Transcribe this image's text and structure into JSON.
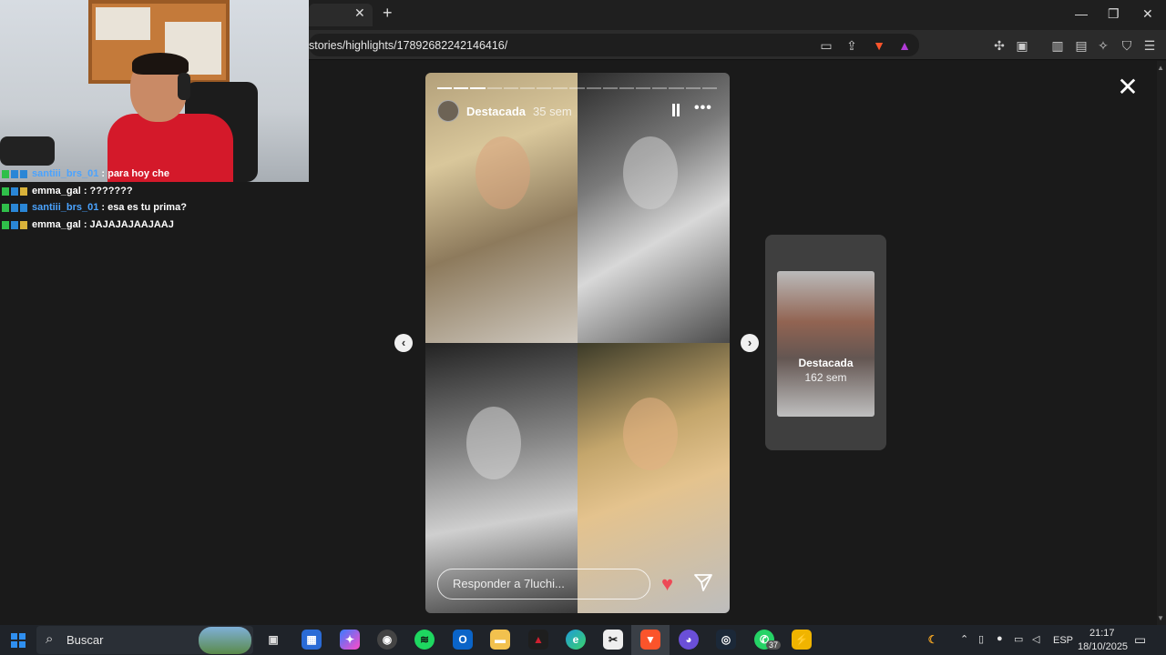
{
  "browser": {
    "url": "stories/highlights/17892682242146416/",
    "tab_close": "✕",
    "new_tab": "+",
    "win_min": "—",
    "win_max": "❐",
    "win_close": "✕"
  },
  "chat": [
    {
      "user": "santiii_brs_01",
      "message": ": para hoy che",
      "user_color": "#4aa3ff"
    },
    {
      "user": "emma_gal",
      "message": ": ???????",
      "user_color": "#ffffff"
    },
    {
      "user": "santiii_brs_01",
      "message": ": esa es tu prima?",
      "user_color": "#4aa3ff"
    },
    {
      "user": "emma_gal",
      "message": ": JAJAJAJAAJAAJ",
      "user_color": "#ffffff"
    }
  ],
  "story": {
    "name": "Destacada",
    "time": "35 sem",
    "progress_total": 17,
    "progress_done": 3,
    "reply_placeholder": "Responder a 7luchi...",
    "more": "•••",
    "heart": "♥",
    "close": "✕",
    "prev": "‹",
    "next": "›"
  },
  "next_preview": {
    "title": "Destacada",
    "time": "162 sem"
  },
  "taskbar": {
    "search_label": "Buscar",
    "lang": "ESP",
    "time": "21:17",
    "date": "18/10/2025",
    "whatsapp_badge": "37"
  }
}
